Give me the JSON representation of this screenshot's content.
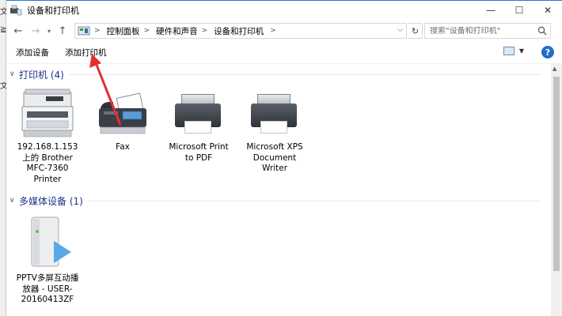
{
  "window": {
    "title": "设备和打印机",
    "controls": {
      "minimize": "—",
      "maximize": "☐",
      "close": "✕"
    }
  },
  "behind_window": {
    "fragments": [
      "文",
      "≧",
      "文"
    ]
  },
  "nav": {
    "back_glyph": "←",
    "forward_glyph": "→",
    "recent_glyph": "▾",
    "up_glyph": "↑",
    "breadcrumb": [
      "控制面板",
      "硬件和声音",
      "设备和打印机"
    ],
    "search": {
      "placeholder": "搜索\"设备和打印机\""
    }
  },
  "toolbar": {
    "add_device": "添加设备",
    "add_printer": "添加打印机",
    "help": "?"
  },
  "groups": [
    {
      "title": "打印机 (4)",
      "devices": [
        {
          "label": "192.168.1.153 上的 Brother MFC-7360 Printer",
          "icon": "multifunction-printer-icon"
        },
        {
          "label": "Fax",
          "icon": "fax-icon"
        },
        {
          "label": "Microsoft Print to PDF",
          "icon": "printer-icon"
        },
        {
          "label": "Microsoft XPS Document Writer",
          "icon": "printer-icon"
        }
      ]
    },
    {
      "title": "多媒体设备 (1)",
      "devices": [
        {
          "label": "PPTV多屏互动播放器 - USER-20160413ZF",
          "icon": "media-device-icon"
        }
      ]
    }
  ],
  "colors": {
    "group_title": "#1e3287",
    "accent": "#1e6fc8",
    "annotation_arrow": "#e03030"
  }
}
